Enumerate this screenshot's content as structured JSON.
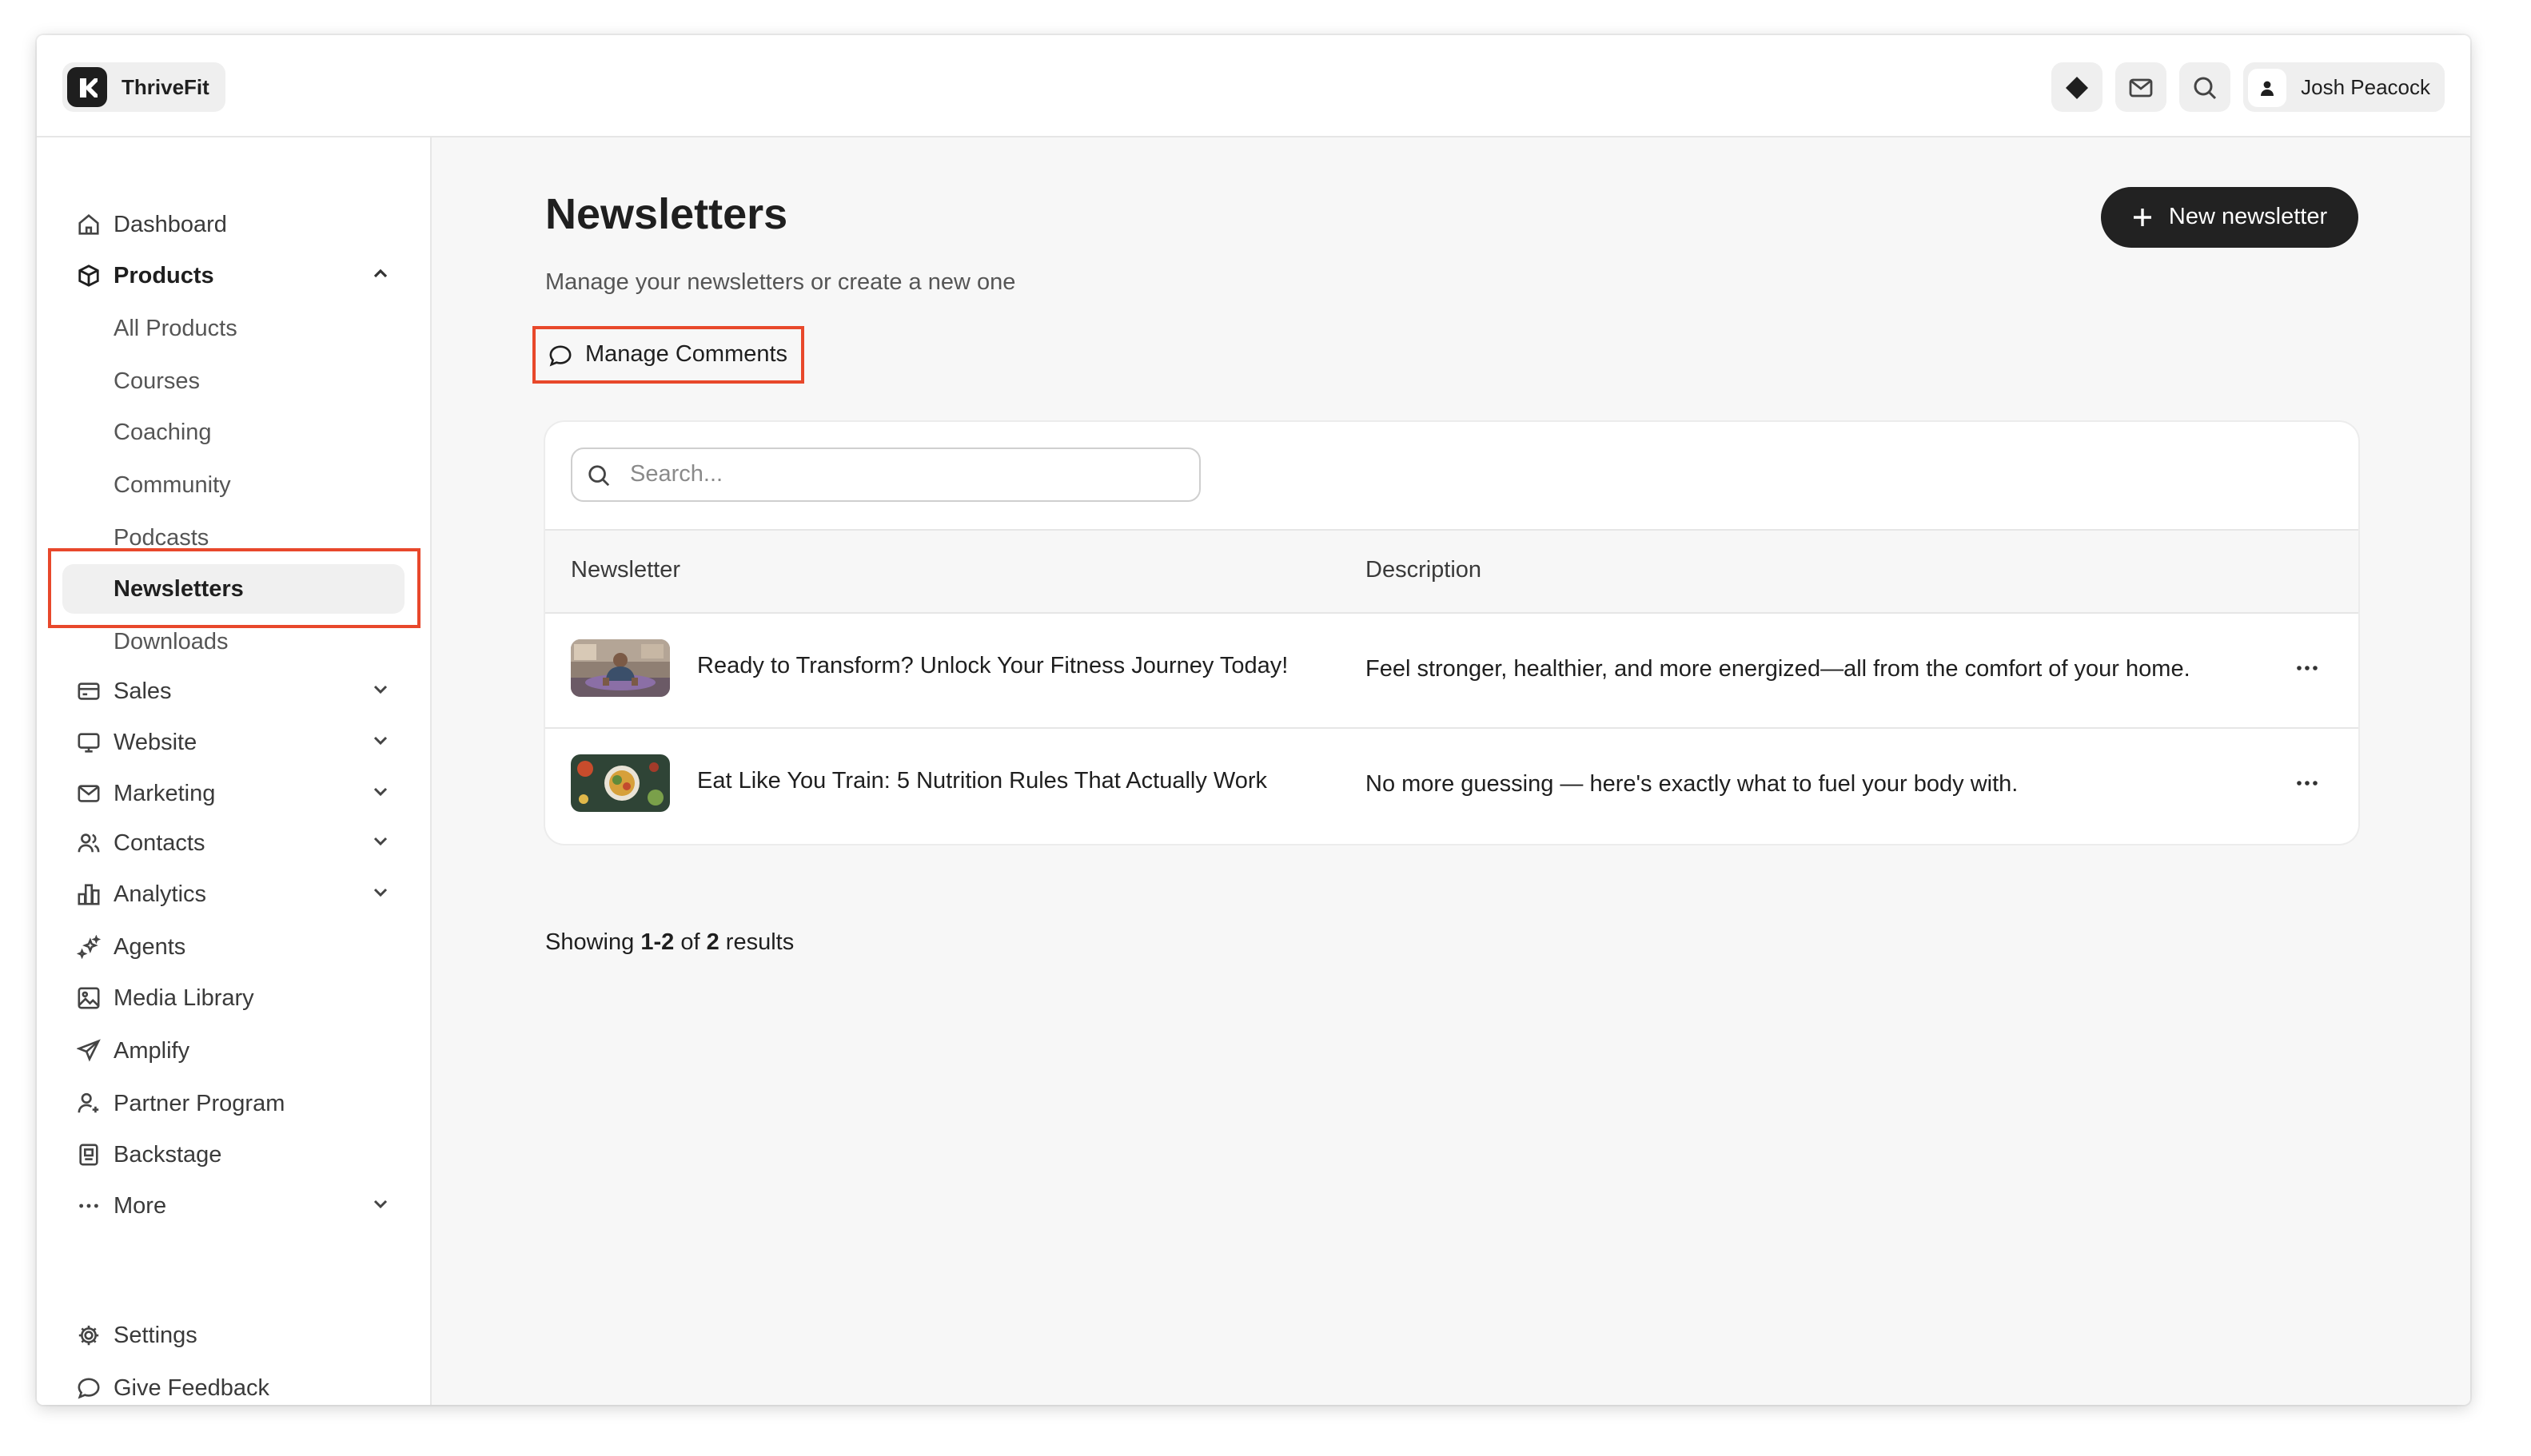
{
  "app": {
    "brand_name": "ThriveFit"
  },
  "topbar": {
    "user_name": "Josh Peacock"
  },
  "sidebar": {
    "items": [
      {
        "label": "Dashboard",
        "icon": "home-icon"
      },
      {
        "label": "Products",
        "icon": "box-icon",
        "expanded": true
      },
      {
        "label": "Sales",
        "icon": "card-icon"
      },
      {
        "label": "Website",
        "icon": "monitor-icon"
      },
      {
        "label": "Marketing",
        "icon": "mail-icon"
      },
      {
        "label": "Contacts",
        "icon": "users-icon"
      },
      {
        "label": "Analytics",
        "icon": "bar-chart-icon"
      },
      {
        "label": "Agents",
        "icon": "sparkles-icon"
      },
      {
        "label": "Media Library",
        "icon": "image-icon"
      },
      {
        "label": "Amplify",
        "icon": "send-icon"
      },
      {
        "label": "Partner Program",
        "icon": "partner-icon"
      },
      {
        "label": "Backstage",
        "icon": "backstage-icon"
      },
      {
        "label": "More",
        "icon": "more-icon"
      }
    ],
    "product_subitems": [
      "All Products",
      "Courses",
      "Coaching",
      "Community",
      "Podcasts",
      "Newsletters",
      "Downloads"
    ],
    "active_subitem": "Newsletters",
    "footer": [
      {
        "label": "Settings",
        "icon": "gear-icon"
      },
      {
        "label": "Give Feedback",
        "icon": "chat-icon"
      }
    ]
  },
  "main": {
    "title": "Newsletters",
    "subtitle": "Manage your newsletters or create a new one",
    "new_button_label": "New newsletter",
    "manage_comments_label": "Manage Comments",
    "search_placeholder": "Search...",
    "columns": [
      "Newsletter",
      "Description"
    ],
    "rows": [
      {
        "name": "Ready to Transform? Unlock Your Fitness Journey Today!",
        "description": "Feel stronger, healthier, and more energized—all from the comfort of your home."
      },
      {
        "name": "Eat Like You Train: 5 Nutrition Rules That Actually Work",
        "description": "No more guessing — here's exactly what to fuel your body with."
      }
    ],
    "results": {
      "prefix": "Showing",
      "range": "1-2",
      "of": "of",
      "total": "2",
      "suffix": "results"
    }
  },
  "colors": {
    "accent_dark": "#222222",
    "highlight": "#e8482b"
  }
}
